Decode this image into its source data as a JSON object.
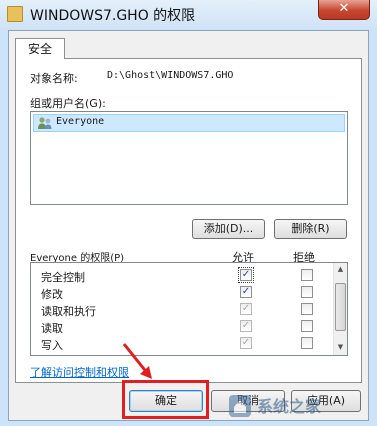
{
  "window": {
    "title": "WINDOWS7.GHO 的权限",
    "close_glyph": "✕"
  },
  "tabs": [
    {
      "label": "安全"
    }
  ],
  "object": {
    "label": "对象名称:",
    "value": "D:\\Ghost\\WINDOWS7.GHO"
  },
  "groups": {
    "label": "组或用户名(G):",
    "items": [
      {
        "name": "Everyone",
        "icon": "users-icon"
      }
    ]
  },
  "buttons": {
    "add": "添加(D)...",
    "remove": "删除(R)",
    "ok": "确定",
    "cancel": "取消",
    "apply": "应用(A)"
  },
  "permissions": {
    "title": "Everyone 的权限(P)",
    "allow_header": "允许",
    "deny_header": "拒绝",
    "rows": [
      {
        "name": "完全控制",
        "allow": true,
        "allow_enabled": true,
        "deny": false
      },
      {
        "name": "修改",
        "allow": true,
        "allow_enabled": true,
        "deny": false
      },
      {
        "name": "读取和执行",
        "allow": true,
        "allow_enabled": false,
        "deny": false
      },
      {
        "name": "读取",
        "allow": true,
        "allow_enabled": false,
        "deny": false
      },
      {
        "name": "写入",
        "allow": true,
        "allow_enabled": false,
        "deny": false
      }
    ]
  },
  "link": {
    "text": "了解访问控制和权限"
  },
  "watermark": {
    "text": "系统之家"
  },
  "colors": {
    "highlight": "#e02020",
    "link": "#0066cc",
    "selection": "#cde8ff"
  }
}
